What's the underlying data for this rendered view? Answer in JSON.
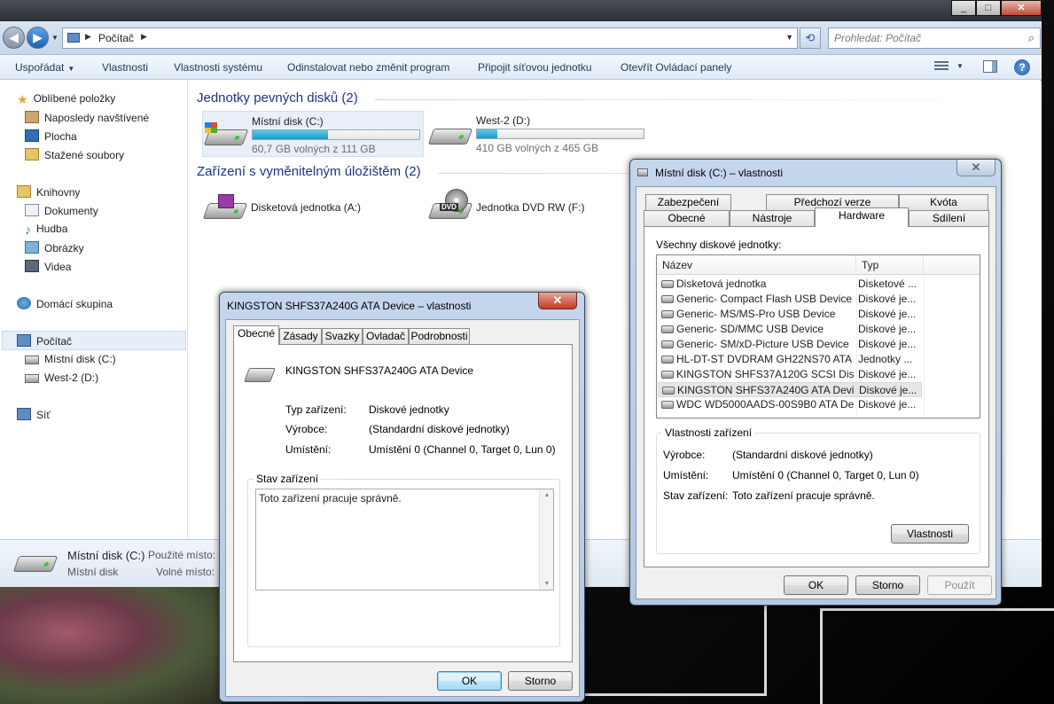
{
  "explorer": {
    "breadcrumb": "Počítač",
    "search_placeholder": "Prohledat: Počítač",
    "commands": {
      "organize": "Uspořádat",
      "properties": "Vlastnosti",
      "system_properties": "Vlastnosti systému",
      "uninstall": "Odinstalovat nebo změnit program",
      "map_drive": "Připojit síťovou jednotku",
      "control_panel": "Otevřít Ovládací panely"
    },
    "nav": {
      "favorites": "Oblíbené položky",
      "recent": "Naposledy navštívené",
      "desktop": "Plocha",
      "downloads": "Stažené soubory",
      "libraries": "Knihovny",
      "documents": "Dokumenty",
      "music": "Hudba",
      "pictures": "Obrázky",
      "videos": "Videa",
      "homegroup": "Domácí skupina",
      "computer": "Počítač",
      "drive_c": "Místní disk (C:)",
      "drive_d": "West-2 (D:)",
      "network": "Síť"
    },
    "groups": {
      "hard_drives": "Jednotky pevných disků (2)",
      "removable": "Zařízení s vyměnitelným úložištěm (2)"
    },
    "drives": [
      {
        "name": "Místní disk (C:)",
        "free_text": "60,7 GB volných z 111 GB",
        "used_fraction": 0.45
      },
      {
        "name": "West-2 (D:)",
        "free_text": "410 GB volných z 465 GB",
        "used_fraction": 0.12
      }
    ],
    "removable": [
      {
        "name": "Disketová jednotka (A:)"
      },
      {
        "name": "Jednotka DVD RW (F:)",
        "badge": "DVD"
      }
    ],
    "details": {
      "name": "Místní disk (C:)",
      "type": "Místní disk",
      "used_label": "Použité místo:",
      "free_label": "Volné místo:"
    }
  },
  "dialog_kingston": {
    "title": "KINGSTON SHFS37A240G ATA Device – vlastnosti",
    "tabs": [
      "Obecné",
      "Zásady",
      "Svazky",
      "Ovladač",
      "Podrobnosti"
    ],
    "device_name": "KINGSTON SHFS37A240G ATA Device",
    "rows": [
      {
        "label": "Typ zařízení:",
        "value": "Diskové jednotky"
      },
      {
        "label": "Výrobce:",
        "value": "(Standardní diskové jednotky)"
      },
      {
        "label": "Umístění:",
        "value": "Umístění 0 (Channel 0, Target 0, Lun 0)"
      }
    ],
    "status_group": "Stav zařízení",
    "status_text": "Toto zařízení pracuje správně.",
    "ok": "OK",
    "cancel": "Storno"
  },
  "dialog_c": {
    "title": "Místní disk (C:) – vlastnosti",
    "tabs_row1": [
      "Zabezpečení",
      "Předchozí verze",
      "Kvóta"
    ],
    "tabs_row2": [
      "Obecné",
      "Nástroje",
      "Hardware",
      "Sdílení"
    ],
    "all_drives_label": "Všechny diskové jednotky:",
    "columns": [
      "Název",
      "Typ"
    ],
    "devices": [
      {
        "name": "Disketová jednotka",
        "type": "Disketové ..."
      },
      {
        "name": "Generic- Compact Flash USB Device",
        "type": "Diskové je..."
      },
      {
        "name": "Generic- MS/MS-Pro USB Device",
        "type": "Diskové je..."
      },
      {
        "name": "Generic- SD/MMC USB Device",
        "type": "Diskové je..."
      },
      {
        "name": "Generic- SM/xD-Picture USB Device",
        "type": "Diskové je..."
      },
      {
        "name": "HL-DT-ST DVDRAM GH22NS70 ATA ...",
        "type": "Jednotky ..."
      },
      {
        "name": "KINGSTON  SHFS37A120G SCSI Disk ...",
        "type": "Diskové je..."
      },
      {
        "name": "KINGSTON SHFS37A240G ATA Device",
        "type": "Diskové je..."
      },
      {
        "name": "WDC WD5000AADS-00S9B0 ATA Dev...",
        "type": "Diskové je..."
      }
    ],
    "props_group": "Vlastnosti zařízení",
    "props": [
      {
        "label": "Výrobce:",
        "value": "(Standardní diskové jednotky)"
      },
      {
        "label": "Umístění:",
        "value": "Umístění 0 (Channel 0, Target 0, Lun 0)"
      },
      {
        "label": "Stav zařízení:",
        "value": "Toto zařízení pracuje správně."
      }
    ],
    "properties_btn": "Vlastnosti",
    "ok": "OK",
    "cancel": "Storno",
    "apply": "Použít"
  }
}
